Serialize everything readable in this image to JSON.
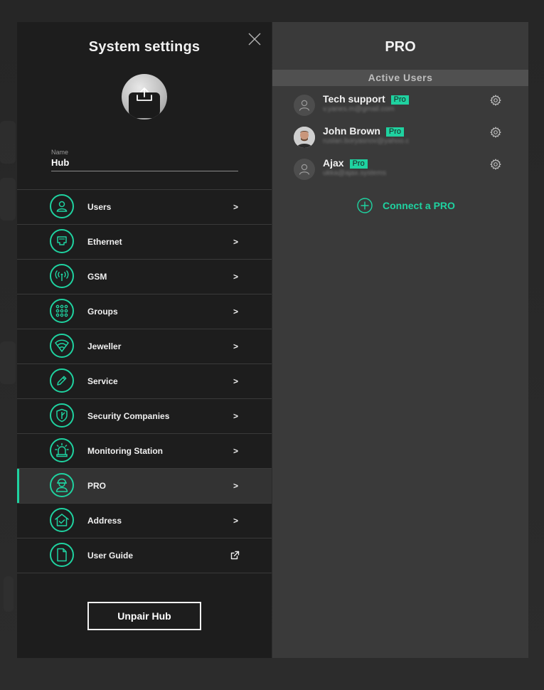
{
  "left_panel": {
    "title": "System settings",
    "name_label": "Name",
    "name_value": "Hub",
    "menu": [
      {
        "label": "Users",
        "arrow": ">",
        "icon": "user-icon"
      },
      {
        "label": "Ethernet",
        "arrow": ">",
        "icon": "ethernet-port-icon"
      },
      {
        "label": "GSM",
        "arrow": ">",
        "icon": "antenna-signal-icon"
      },
      {
        "label": "Groups",
        "arrow": ">",
        "icon": "grid-dots-icon"
      },
      {
        "label": "Jeweller",
        "arrow": ">",
        "icon": "wifi-shield-icon"
      },
      {
        "label": "Service",
        "arrow": ">",
        "icon": "pencil-icon"
      },
      {
        "label": "Security Companies",
        "arrow": ">",
        "icon": "shield-icon"
      },
      {
        "label": "Monitoring Station",
        "arrow": ">",
        "icon": "siren-icon"
      },
      {
        "label": "PRO",
        "arrow": ">",
        "icon": "installer-icon",
        "active": true
      },
      {
        "label": "Address",
        "arrow": ">",
        "icon": "house-check-icon"
      },
      {
        "label": "User Guide",
        "arrow": "",
        "icon": "document-icon",
        "external": true
      }
    ],
    "unpair_label": "Unpair Hub"
  },
  "right_panel": {
    "title": "PRO",
    "section_label": "Active Users",
    "users": [
      {
        "name": "Tech support",
        "badge": "Pro",
        "email": "v.yanes.m@gmail.com"
      },
      {
        "name": "John Brown",
        "badge": "Pro",
        "email": "ruslan.boryasnov@yahoo.c"
      },
      {
        "name": "Ajax",
        "badge": "Pro",
        "email": "ukka@ajax.systems"
      }
    ],
    "connect_label": "Connect a PRO"
  },
  "colors": {
    "accent": "#1fd2a0",
    "left_bg": "#1d1d1d",
    "right_bg": "#3a3a3a",
    "section_bg": "#505050"
  }
}
